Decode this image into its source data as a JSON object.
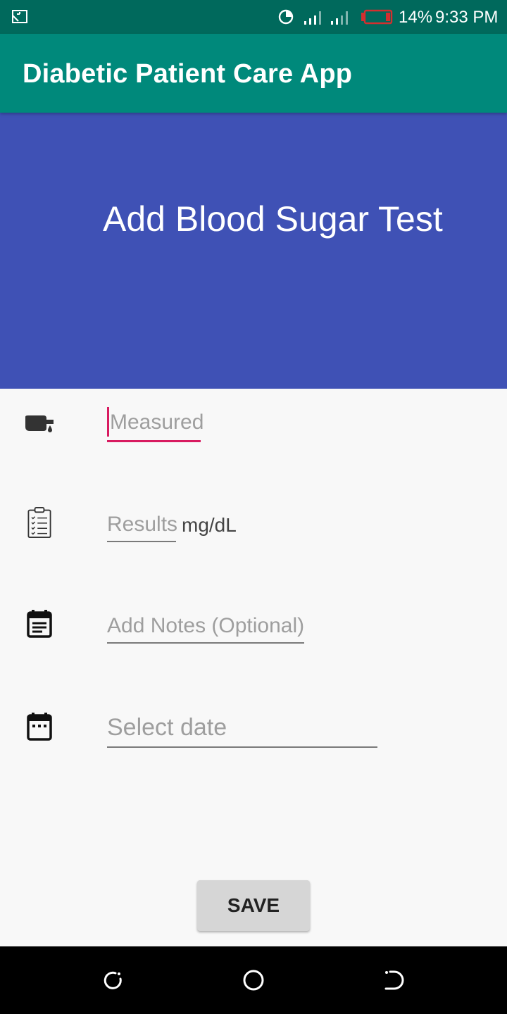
{
  "status_bar": {
    "battery_percent": "14%",
    "time": "9:33 PM",
    "battery_color": "#d32f2f",
    "icons": [
      "screen-cast-icon",
      "data-saver-icon",
      "signal-icon",
      "signal-icon",
      "battery-icon"
    ]
  },
  "app_bar": {
    "title": "Diabetic Patient Care App",
    "color": "#00897b"
  },
  "hero": {
    "heading": "Add Blood Sugar Test",
    "color": "#3f51b5"
  },
  "form": {
    "measured": {
      "placeholder": "Measured",
      "icon": "glucometer-icon",
      "focused": true,
      "accent": "#d81b60"
    },
    "results": {
      "placeholder": "Results",
      "unit": "mg/dL",
      "icon": "checklist-clipboard-icon"
    },
    "notes": {
      "placeholder": "Add Notes (Optional)",
      "icon": "notes-calendar-icon"
    },
    "date": {
      "placeholder": "Select date",
      "icon": "calendar-icon"
    }
  },
  "save_label": "SAVE",
  "nav_bar": {
    "icons": [
      "recent-apps-icon",
      "home-icon",
      "back-icon"
    ]
  }
}
